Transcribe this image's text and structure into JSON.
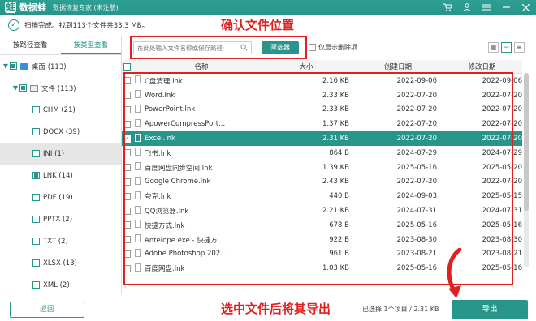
{
  "app": {
    "name": "数据蛙",
    "subtitle": "数据恢复专家 (未注册)"
  },
  "status": {
    "text": "扫描完成。找到113个文件共33.3 MB。"
  },
  "sidebar": {
    "tabs": [
      "按路径查看",
      "按类型查看"
    ],
    "tree": [
      {
        "label": "桌面 (113)"
      },
      {
        "label": "文件 (113)"
      },
      {
        "label": "CHM (21)"
      },
      {
        "label": "DOCX (39)"
      },
      {
        "label": "INI (1)"
      },
      {
        "label": "LNK (14)"
      },
      {
        "label": "PDF (19)"
      },
      {
        "label": "PPTX (2)"
      },
      {
        "label": "TXT (2)"
      },
      {
        "label": "XLSX (13)"
      },
      {
        "label": "XML (2)"
      }
    ]
  },
  "toolbar": {
    "search_placeholder": "在此处输入文件名称或保存路径",
    "filter_label": "筛选器",
    "only_deleted_label": "仅显示删除项"
  },
  "annotations": {
    "top": "确认文件位置",
    "bottom": "选中文件后将其导出"
  },
  "table": {
    "headers": {
      "name": "名称",
      "size": "大小",
      "created": "创建日期",
      "modified": "修改日期"
    },
    "rows": [
      {
        "name": "C盘清理.lnk",
        "size": "2.16 KB",
        "created": "2022-09-06",
        "modified": "2022-09-06"
      },
      {
        "name": "Word.lnk",
        "size": "2.33 KB",
        "created": "2022-07-20",
        "modified": "2022-07-20"
      },
      {
        "name": "PowerPoint.lnk",
        "size": "2.33 KB",
        "created": "2022-07-20",
        "modified": "2022-07-20"
      },
      {
        "name": "ApowerCompressPort...",
        "size": "1.37 KB",
        "created": "2022-07-20",
        "modified": "2022-07-20"
      },
      {
        "name": "Excel.lnk",
        "size": "2.31 KB",
        "created": "2022-07-20",
        "modified": "2022-07-20"
      },
      {
        "name": "飞书.lnk",
        "size": "864 B",
        "created": "2024-07-29",
        "modified": "2024-07-29"
      },
      {
        "name": "百度网盘同步空间.lnk",
        "size": "1.39 KB",
        "created": "2025-05-16",
        "modified": "2025-05-20"
      },
      {
        "name": "Google Chrome.lnk",
        "size": "2.43 KB",
        "created": "2022-07-20",
        "modified": "2022-07-20"
      },
      {
        "name": "夸克.lnk",
        "size": "440 B",
        "created": "2024-09-03",
        "modified": "2025-05-15"
      },
      {
        "name": "QQ浏览器.lnk",
        "size": "2.21 KB",
        "created": "2024-07-31",
        "modified": "2024-07-31"
      },
      {
        "name": "快捷方式.lnk",
        "size": "678 B",
        "created": "2025-05-16",
        "modified": "2025-05-16"
      },
      {
        "name": "Antelope.exe - 快捷方...",
        "size": "922 B",
        "created": "2023-08-30",
        "modified": "2023-08-30"
      },
      {
        "name": "Adobe Photoshop 202...",
        "size": "961 B",
        "created": "2023-08-21",
        "modified": "2023-08-21"
      },
      {
        "name": "百度网盘.lnk",
        "size": "1.03 KB",
        "created": "2025-05-16",
        "modified": "2025-05-16"
      }
    ]
  },
  "bottom": {
    "back_label": "返回",
    "selection_info": "已选择 1个项目 / 2.31 KB",
    "export_label": "导出"
  },
  "colors": {
    "accent": "#27958a",
    "annotation": "#e02020"
  }
}
